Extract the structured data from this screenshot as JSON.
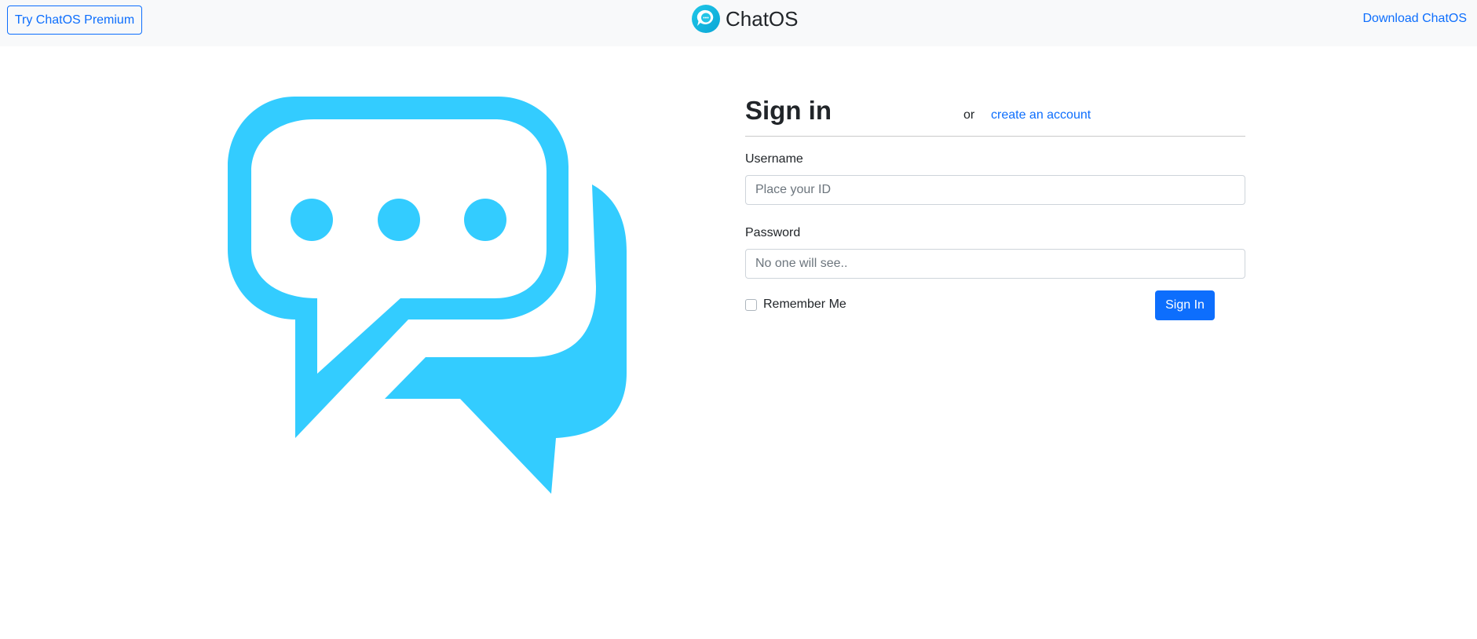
{
  "navbar": {
    "premium_button": "Try ChatOS Premium",
    "brand_name": "ChatOS",
    "download_link": "Download ChatOS"
  },
  "hero": {
    "icon": "chat-bubbles-icon",
    "color": "#33ccff"
  },
  "form": {
    "title": "Sign in",
    "or_text": "or",
    "create_account_link": "create an account",
    "username_label": "Username",
    "username_placeholder": "Place your ID",
    "password_label": "Password",
    "password_placeholder": "No one will see..",
    "remember_label": "Remember Me",
    "remember_checked": false,
    "submit_label": "Sign In"
  },
  "colors": {
    "accent": "#0d6efd",
    "navbar_bg": "#f8f9fa",
    "illustration": "#33ccff"
  }
}
